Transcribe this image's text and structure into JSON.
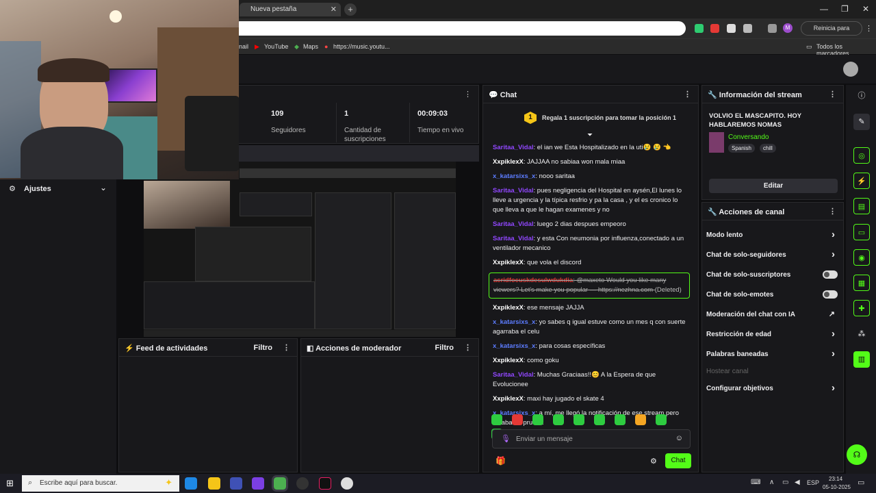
{
  "browser": {
    "tab_title": "Nueva pestaña",
    "update_label": "Reinicia para actualizar",
    "bookmarks": [
      "nail",
      "YouTube",
      "Maps",
      "https://music.youtu..."
    ],
    "all_bookmarks": "Todos los marcadores",
    "profile_initial": "M"
  },
  "stats": [
    {
      "value": "109",
      "label": "Seguidores"
    },
    {
      "value": "1",
      "label": "Cantidad de suscripciones"
    },
    {
      "value": "00:09:03",
      "label": "Tiempo en vivo"
    }
  ],
  "left": {
    "settings_label": "Ajustes"
  },
  "activity_feed": {
    "title": "Feed de actividades",
    "filter": "Filtro"
  },
  "mod_actions": {
    "title": "Acciones de moderador",
    "filter": "Filtro"
  },
  "chat": {
    "title": "Chat",
    "pinned_badge": "1",
    "pinned_text": "Regala 1 suscripción para tomar la posición 1",
    "messages": [
      {
        "user": "Saritaa_Vidal",
        "color": "#9147ff",
        "text": "el ian we Esta Hospitalizado en la uti😢 😢 👈"
      },
      {
        "user": "XxpiklexX",
        "color": "#ffffff",
        "text": "JAJJAA no sabiaa won mala miaa"
      },
      {
        "user": "x_katarsixs_x",
        "color": "#5c7cff",
        "text": "nooo saritaa"
      },
      {
        "user": "Saritaa_Vidal",
        "color": "#9147ff",
        "text": "pues negligencia del Hospital en aysén,El lunes lo lleve a urgencia y la típica resfrio y pa la casa , y el es cronico lo que lleva a que le hagan examenes y no"
      },
      {
        "user": "Saritaa_Vidal",
        "color": "#9147ff",
        "text": "luego 2 dias despues empeoro"
      },
      {
        "user": "Saritaa_Vidal",
        "color": "#9147ff",
        "text": "y esta Con neumonia por influenza,conectado a un ventilador mecanico"
      },
      {
        "user": "XxpiklexX",
        "color": "#ffffff",
        "text": "que vola el discord"
      },
      {
        "user": "XxpiklexX",
        "color": "#ffffff",
        "text": "ese mensaje JAJJA"
      },
      {
        "user": "x_katarsixs_x",
        "color": "#5c7cff",
        "text": "yo sabes q igual estuve como un mes q con suerte agarraba el celu"
      },
      {
        "user": "x_katarsixs_x",
        "color": "#5c7cff",
        "text": "para cosas específicas"
      },
      {
        "user": "XxpiklexX",
        "color": "#ffffff",
        "text": "como goku"
      },
      {
        "user": "Saritaa_Vidal",
        "color": "#9147ff",
        "text": "Muchas Graciaas!!😊 A la Espera de que Evolucionee"
      },
      {
        "user": "XxpiklexX",
        "color": "#ffffff",
        "text": "maxi hay jugado el skate 4"
      },
      {
        "user": "x_katarsixs_x",
        "color": "#5c7cff",
        "text": "a mí, me llegó la notificación de ese stream pero estaba en prueba"
      }
    ],
    "deleted": {
      "user": "acridfocuskdesulwdukdia",
      "text": "@maxeto Would you like many viewers? Let's make you popular — https://nezhna.com",
      "tag": "(Deleted)"
    },
    "input_placeholder": "Enviar un mensaje",
    "send_label": "Chat"
  },
  "stream_info": {
    "title": "Información del stream",
    "stream_title": "VOLVIO EL MASCAPITO. HOY HABLAREMOS NOMAS",
    "category": "Conversando",
    "tags": [
      "Spanish",
      "chill"
    ],
    "edit_label": "Editar"
  },
  "channel_actions": {
    "title": "Acciones de canal",
    "items": [
      {
        "label": "Modo lento",
        "kind": "chevron"
      },
      {
        "label": "Chat de solo-seguidores",
        "kind": "chevron"
      },
      {
        "label": "Chat de solo-suscriptores",
        "kind": "toggle"
      },
      {
        "label": "Chat de solo-emotes",
        "kind": "toggle"
      },
      {
        "label": "Moderación del chat con IA",
        "kind": "external"
      },
      {
        "label": "Restricción de edad",
        "kind": "chevron"
      },
      {
        "label": "Palabras baneadas",
        "kind": "chevron"
      },
      {
        "label": "Hostear canal",
        "kind": "disabled"
      },
      {
        "label": "Configurar objetivos",
        "kind": "chevron"
      }
    ]
  },
  "taskbar": {
    "search_placeholder": "Escribe aquí para buscar.",
    "lang": "ESP",
    "time": "23:14",
    "date": "05-10-2025"
  },
  "colors": {
    "accent": "#53fc18",
    "chat_border": "#53fc18",
    "background": "#0e0e10",
    "panel": "#18181b"
  }
}
